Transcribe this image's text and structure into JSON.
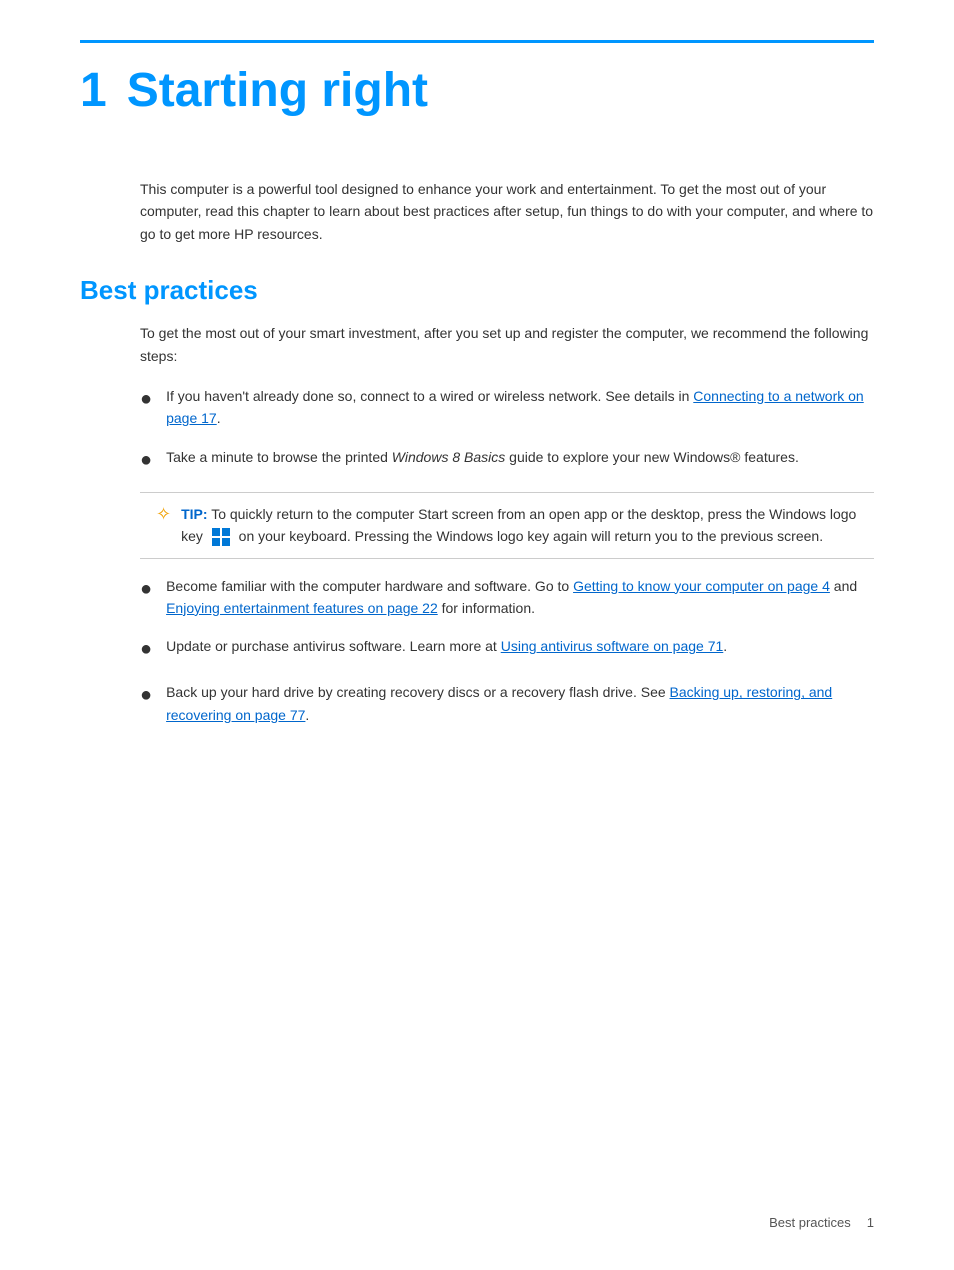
{
  "page": {
    "top_border": true,
    "chapter_number": "1",
    "chapter_title": "Starting right",
    "intro": "This computer is a powerful tool designed to enhance your work and entertainment. To get the most out of your computer, read this chapter to learn about best practices after setup, fun things to do with your computer, and where to go to get more HP resources.",
    "section_title": "Best practices",
    "section_intro": "To get the most out of your smart investment, after you set up and register the computer, we recommend the following steps:",
    "bullets": [
      {
        "id": "bullet-1",
        "text_before": "If you haven’t already done so, connect to a wired or wireless network. See details in ",
        "link_text": "Connecting to a network on page 17",
        "text_after": "."
      },
      {
        "id": "bullet-2",
        "text_before": "Take a minute to browse the printed ",
        "italic": "Windows 8 Basics",
        "text_after": " guide to explore your new Windows® features."
      }
    ],
    "tip_box": {
      "label": "TIP:",
      "text": "  To quickly return to the computer Start screen from an open app or the desktop, press the Windows logo key",
      "text_after": " on your keyboard. Pressing the Windows logo key again will return you to the previous screen."
    },
    "bullets2": [
      {
        "id": "bullet-3",
        "text_before": "Become familiar with the computer hardware and software. Go to ",
        "link1_text": "Getting to know your computer on page 4",
        "text_mid": " and ",
        "link2_text": "Enjoying entertainment features on page 22",
        "text_after": " for information."
      },
      {
        "id": "bullet-4",
        "text_before": "Update or purchase antivirus software. Learn more at ",
        "link_text": "Using antivirus software on page 71",
        "text_after": "."
      },
      {
        "id": "bullet-5",
        "text_before": "Back up your hard drive by creating recovery discs or a recovery flash drive. See ",
        "link_text": "Backing up, restoring, and recovering on page 77",
        "text_after": "."
      }
    ],
    "footer": {
      "section_label": "Best practices",
      "page_number": "1"
    }
  }
}
